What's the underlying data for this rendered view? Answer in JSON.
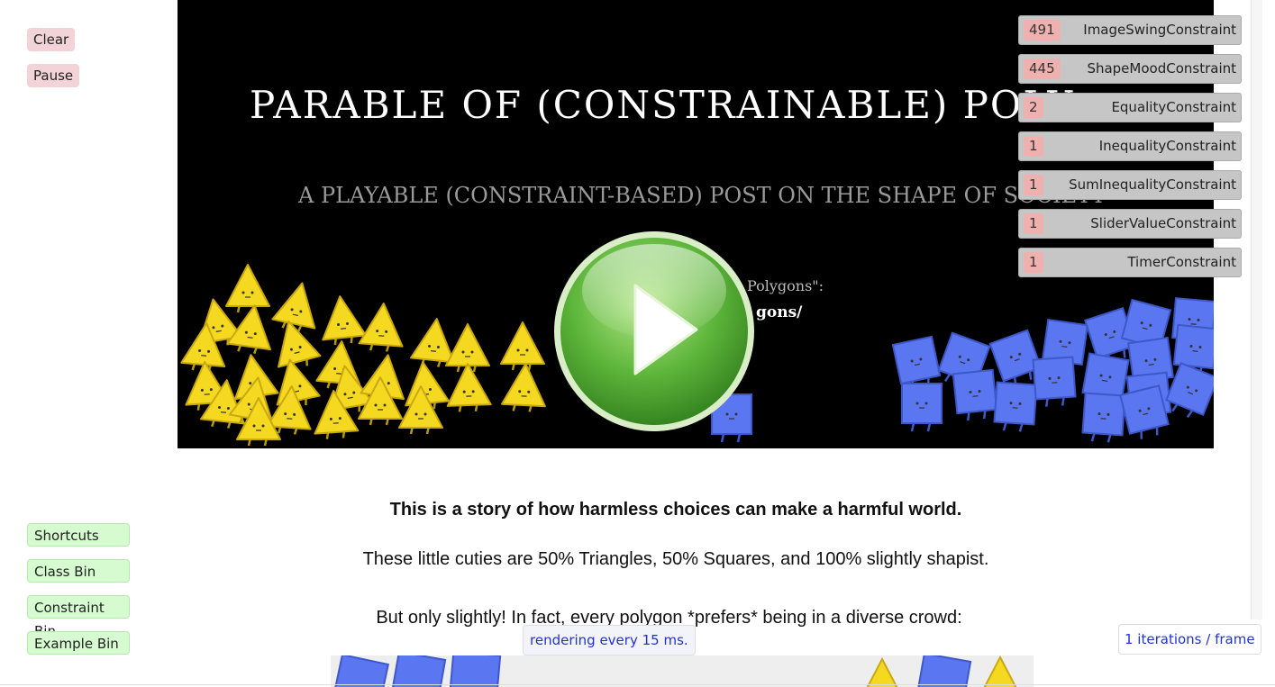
{
  "left_controls": {
    "clear_label": "Clear",
    "pause_label": "Pause"
  },
  "left_bins": {
    "shortcuts_label": "Shortcuts",
    "class_bin_label": "Class Bin",
    "constraint_bin_label": "Constraint Bin",
    "example_bin_label": "Example Bin"
  },
  "banner": {
    "title": "PARABLE OF (CONSTRAINABLE) POLY",
    "subtitle": "A PLAYABLE (CONSTRAINT-BASED) POST ON THE SHAPE OF SOCIETY",
    "line1": "Polygons\":",
    "line2": "gons/",
    "play_icon": "play-button-icon"
  },
  "constraints": [
    {
      "count": "491",
      "name": "ImageSwingConstraint"
    },
    {
      "count": "445",
      "name": "ShapeMoodConstraint"
    },
    {
      "count": "2",
      "name": "EqualityConstraint"
    },
    {
      "count": "1",
      "name": "InequalityConstraint"
    },
    {
      "count": "1",
      "name": "SumInequalityConstraint"
    },
    {
      "count": "1",
      "name": "SliderValueConstraint"
    },
    {
      "count": "1",
      "name": "TimerConstraint"
    }
  ],
  "article": {
    "heading": "This is a story of how harmless choices can make a harmful world.",
    "para1": "These little cuties are 50% Triangles, 50% Squares, and 100% slightly shapist.",
    "para2": "But only slightly! In fact, every polygon *prefers* being in a diverse crowd:"
  },
  "status": {
    "render_note": "rendering every 15 ms.",
    "iterations": "1 iterations / frame"
  },
  "colors": {
    "triangle": "#f5d820",
    "square": "#5a76f0",
    "banner_bg": "#000000",
    "count_badge": "#efb0b0"
  }
}
